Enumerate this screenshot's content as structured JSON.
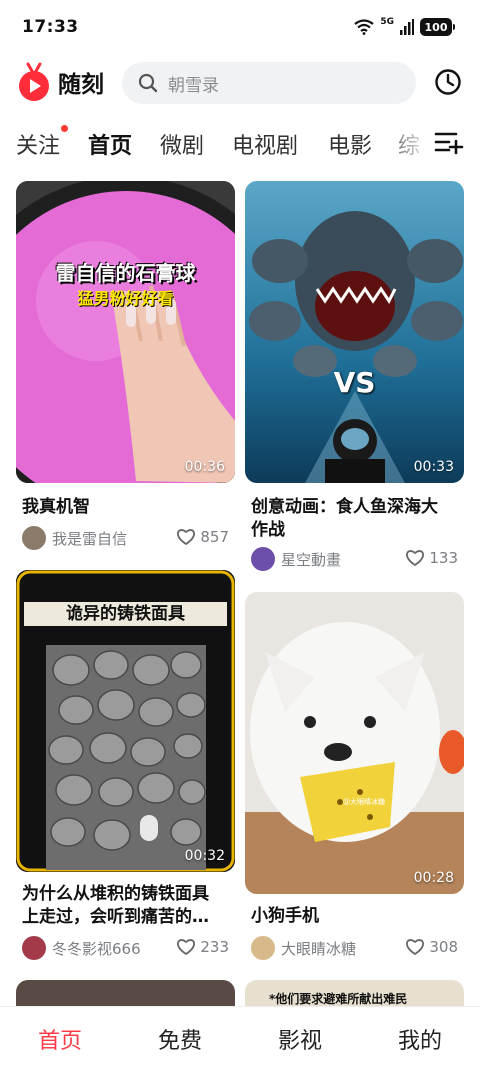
{
  "status": {
    "time": "17:33",
    "network": "5G",
    "battery": "100"
  },
  "header": {
    "app_name": "随刻",
    "search_placeholder": "朝雪录"
  },
  "tabs": [
    {
      "label": "关注",
      "has_dot": true
    },
    {
      "label": "首页",
      "active": true
    },
    {
      "label": "微剧"
    },
    {
      "label": "电视剧"
    },
    {
      "label": "电影"
    },
    {
      "label": "综"
    }
  ],
  "feed": [
    {
      "title": "我真机智",
      "duration": "00:36",
      "overlay_title": "雷自信的石膏球",
      "overlay_subtitle": "猛男粉好好看",
      "author": "我是雷自信",
      "likes": "857"
    },
    {
      "title": "创意动画：食人鱼深海大作战",
      "title_line1": "创意动画：食人鱼深海大",
      "title_line2": "作战",
      "duration": "00:33",
      "overlay_text": "VS",
      "author": "星空動畫",
      "likes": "133"
    },
    {
      "title": "为什么从堆积的铸铁面具上走过，会听到痛苦的…",
      "title_line1": "为什么从堆积的铸铁面具",
      "title_line2": "上走过，会听到痛苦的…",
      "duration": "00:32",
      "overlay_title": "诡异的铸铁面具",
      "author": "冬冬影视666",
      "likes": "233"
    },
    {
      "title": "小狗手机",
      "duration": "00:28",
      "watermark": "@大眼睛冰糖",
      "author": "大眼睛冰糖",
      "likes": "308"
    },
    {
      "overlay_text": "*他们要求避难所献出难民"
    }
  ],
  "bottom_nav": [
    {
      "label": "首页",
      "active": true
    },
    {
      "label": "免费"
    },
    {
      "label": "影视"
    },
    {
      "label": "我的"
    }
  ],
  "colors": {
    "accent": "#ff3b47",
    "pink_ball": "#e65ad6",
    "water": "#2a7fa8"
  }
}
